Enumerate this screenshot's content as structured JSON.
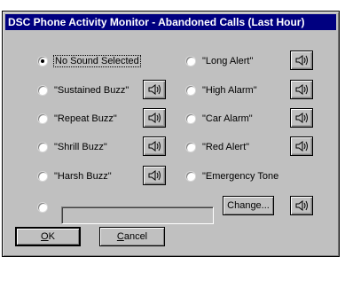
{
  "window": {
    "title": "DSC Phone Activity Monitor - Abandoned Calls (Last Hour)"
  },
  "options_left": [
    {
      "label": "No Sound Selected",
      "checked": true
    },
    {
      "label": "\"Sustained Buzz\"",
      "checked": false
    },
    {
      "label": "\"Repeat Buzz\"",
      "checked": false
    },
    {
      "label": "\"Shrill Buzz\"",
      "checked": false
    },
    {
      "label": "\"Harsh Buzz\"",
      "checked": false
    }
  ],
  "options_right": [
    {
      "label": "\"Long Alert\"",
      "checked": false
    },
    {
      "label": "\"High Alarm\"",
      "checked": false
    },
    {
      "label": "\"Car Alarm\"",
      "checked": false
    },
    {
      "label": "\"Red Alert\"",
      "checked": false
    },
    {
      "label": "\"Emergency Tone",
      "checked": false
    }
  ],
  "custom": {
    "value": "",
    "change_label": "Change..."
  },
  "buttons": {
    "ok_first": "O",
    "ok_rest": "K",
    "cancel_first": "C",
    "cancel_rest": "ancel"
  },
  "icons": {
    "play": "speaker-icon"
  }
}
